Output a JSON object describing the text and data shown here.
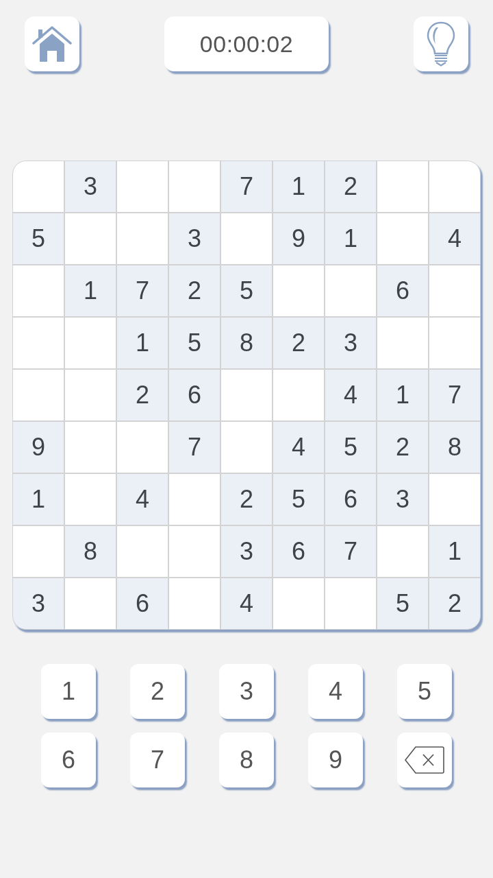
{
  "top_bar": {
    "timer": "00:00:02"
  },
  "grid": {
    "rows": [
      [
        {
          "given": false
        },
        {
          "given": true,
          "value": "3"
        },
        {
          "given": false
        },
        {
          "given": false
        },
        {
          "given": true,
          "value": "7"
        },
        {
          "given": true,
          "value": "1"
        },
        {
          "given": true,
          "value": "2"
        },
        {
          "given": false
        },
        {
          "given": false
        }
      ],
      [
        {
          "given": true,
          "value": "5"
        },
        {
          "given": false
        },
        {
          "given": false
        },
        {
          "given": true,
          "value": "3"
        },
        {
          "given": false
        },
        {
          "given": true,
          "value": "9"
        },
        {
          "given": true,
          "value": "1"
        },
        {
          "given": false
        },
        {
          "given": true,
          "value": "4"
        }
      ],
      [
        {
          "given": false
        },
        {
          "given": true,
          "value": "1"
        },
        {
          "given": true,
          "value": "7"
        },
        {
          "given": true,
          "value": "2"
        },
        {
          "given": true,
          "value": "5"
        },
        {
          "given": false
        },
        {
          "given": false
        },
        {
          "given": true,
          "value": "6"
        },
        {
          "given": false
        }
      ],
      [
        {
          "given": false
        },
        {
          "given": false
        },
        {
          "given": true,
          "value": "1"
        },
        {
          "given": true,
          "value": "5"
        },
        {
          "given": true,
          "value": "8"
        },
        {
          "given": true,
          "value": "2"
        },
        {
          "given": true,
          "value": "3"
        },
        {
          "given": false
        },
        {
          "given": false
        }
      ],
      [
        {
          "given": false
        },
        {
          "given": false
        },
        {
          "given": true,
          "value": "2"
        },
        {
          "given": true,
          "value": "6"
        },
        {
          "given": false
        },
        {
          "given": false
        },
        {
          "given": true,
          "value": "4"
        },
        {
          "given": true,
          "value": "1"
        },
        {
          "given": true,
          "value": "7"
        }
      ],
      [
        {
          "given": true,
          "value": "9"
        },
        {
          "given": false
        },
        {
          "given": false
        },
        {
          "given": true,
          "value": "7"
        },
        {
          "given": false
        },
        {
          "given": true,
          "value": "4"
        },
        {
          "given": true,
          "value": "5"
        },
        {
          "given": true,
          "value": "2"
        },
        {
          "given": true,
          "value": "8"
        }
      ],
      [
        {
          "given": true,
          "value": "1"
        },
        {
          "given": false
        },
        {
          "given": true,
          "value": "4"
        },
        {
          "given": false
        },
        {
          "given": true,
          "value": "2"
        },
        {
          "given": true,
          "value": "5"
        },
        {
          "given": true,
          "value": "6"
        },
        {
          "given": true,
          "value": "3"
        },
        {
          "given": false
        }
      ],
      [
        {
          "given": false
        },
        {
          "given": true,
          "value": "8"
        },
        {
          "given": false
        },
        {
          "given": false
        },
        {
          "given": true,
          "value": "3"
        },
        {
          "given": true,
          "value": "6"
        },
        {
          "given": true,
          "value": "7"
        },
        {
          "given": false
        },
        {
          "given": true,
          "value": "1"
        }
      ],
      [
        {
          "given": true,
          "value": "3"
        },
        {
          "given": false
        },
        {
          "given": true,
          "value": "6"
        },
        {
          "given": false
        },
        {
          "given": true,
          "value": "4"
        },
        {
          "given": false
        },
        {
          "given": false
        },
        {
          "given": true,
          "value": "5"
        },
        {
          "given": true,
          "value": "2"
        }
      ]
    ]
  },
  "keypad": {
    "keys": [
      {
        "kind": "digit",
        "label": "1"
      },
      {
        "kind": "digit",
        "label": "2"
      },
      {
        "kind": "digit",
        "label": "3"
      },
      {
        "kind": "digit",
        "label": "4"
      },
      {
        "kind": "digit",
        "label": "5"
      },
      {
        "kind": "digit",
        "label": "6"
      },
      {
        "kind": "digit",
        "label": "7"
      },
      {
        "kind": "digit",
        "label": "8"
      },
      {
        "kind": "digit",
        "label": "9"
      },
      {
        "kind": "backspace"
      }
    ]
  }
}
